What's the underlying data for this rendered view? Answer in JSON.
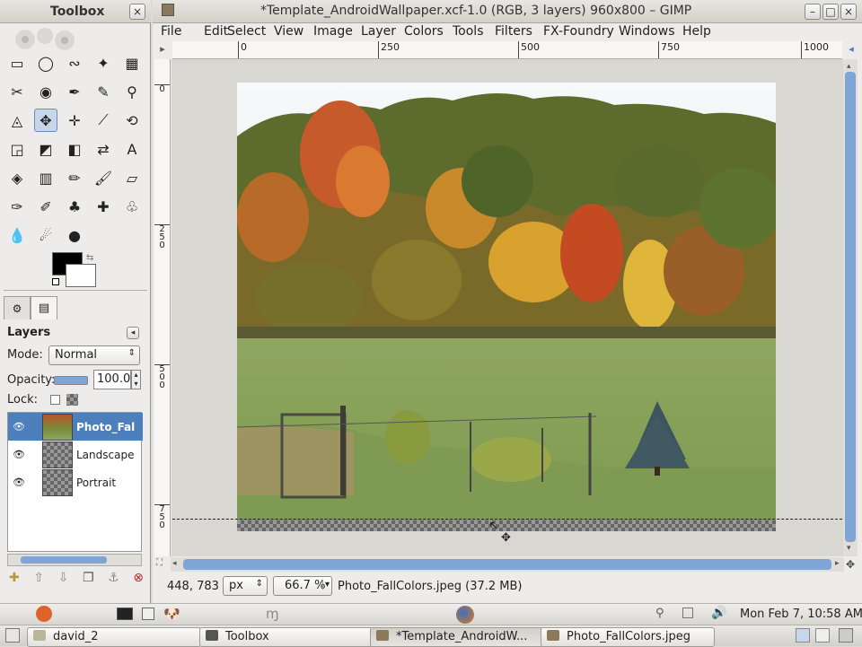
{
  "toolbox": {
    "title": "Toolbox",
    "close": "×",
    "tools": [
      [
        "rect-select-icon",
        "ellipse-select-icon",
        "free-select-icon",
        "fuzzy-select-icon",
        "color-select-icon"
      ],
      [
        "scissors-icon",
        "foreground-select-icon",
        "paths-icon",
        "color-picker-icon",
        "zoom-icon"
      ],
      [
        "measure-icon",
        "move-icon",
        "align-icon",
        "crop-icon",
        "rotate-icon"
      ],
      [
        "scale-icon",
        "shear-icon",
        "perspective-icon",
        "flip-icon",
        "text-icon"
      ],
      [
        "bucket-fill-icon",
        "blend-icon",
        "pencil-icon",
        "paintbrush-icon",
        "eraser-icon"
      ],
      [
        "airbrush-icon",
        "ink-icon",
        "clone-icon",
        "heal-icon",
        "perspective-clone-icon"
      ],
      [
        "blur-icon",
        "smudge-icon",
        "dodge-burn-icon"
      ]
    ],
    "tool_glyphs": [
      [
        "▭",
        "◯",
        "∾",
        "✦",
        "▦"
      ],
      [
        "✂",
        "◉",
        "✒",
        "✎",
        "⚲"
      ],
      [
        "◬",
        "✥",
        "✛",
        "⟋",
        "⟲"
      ],
      [
        "◲",
        "◩",
        "◧",
        "⇄",
        "A"
      ],
      [
        "◈",
        "▥",
        "✏",
        "🖌",
        "▱"
      ],
      [
        "✑",
        "✐",
        "♣",
        "✚",
        "♧"
      ],
      [
        "💧",
        "☄",
        "●"
      ]
    ]
  },
  "layers": {
    "title": "Layers",
    "mode_label": "Mode:",
    "mode_value": "Normal",
    "opacity_label": "Opacity:",
    "opacity_value": "100.0",
    "lock_label": "Lock:",
    "items": [
      {
        "name": "Photo_Fal",
        "selected": true
      },
      {
        "name": "Landscape",
        "selected": false
      },
      {
        "name": "Portrait",
        "selected": false
      }
    ]
  },
  "window": {
    "title": "*Template_AndroidWallpaper.xcf-1.0 (RGB, 3 layers) 960x800 – GIMP"
  },
  "menu": [
    "File",
    "Edit",
    "Select",
    "View",
    "Image",
    "Layer",
    "Colors",
    "Tools",
    "Filters",
    "FX-Foundry",
    "Windows",
    "Help"
  ],
  "ruler": {
    "h_ticks": [
      "0",
      "250",
      "500",
      "750",
      "1000"
    ],
    "v_ticks": [
      "0",
      "250",
      "500",
      "750"
    ]
  },
  "status": {
    "coords": "448, 783",
    "unit": "px",
    "zoom": "66.7 %",
    "info": "Photo_FallColors.jpeg (37.2 MB)"
  },
  "panel": {
    "clock": "Mon Feb 7, 10:58 AM"
  },
  "taskbar": [
    {
      "label": "david_2",
      "active": false
    },
    {
      "label": "Toolbox",
      "active": false
    },
    {
      "label": "*Template_AndroidW...",
      "active": true
    },
    {
      "label": "Photo_FallColors.jpeg",
      "active": false
    }
  ],
  "colors": {
    "selection": "#4e7fbd",
    "fg": "#000000",
    "bg": "#ffffff"
  }
}
